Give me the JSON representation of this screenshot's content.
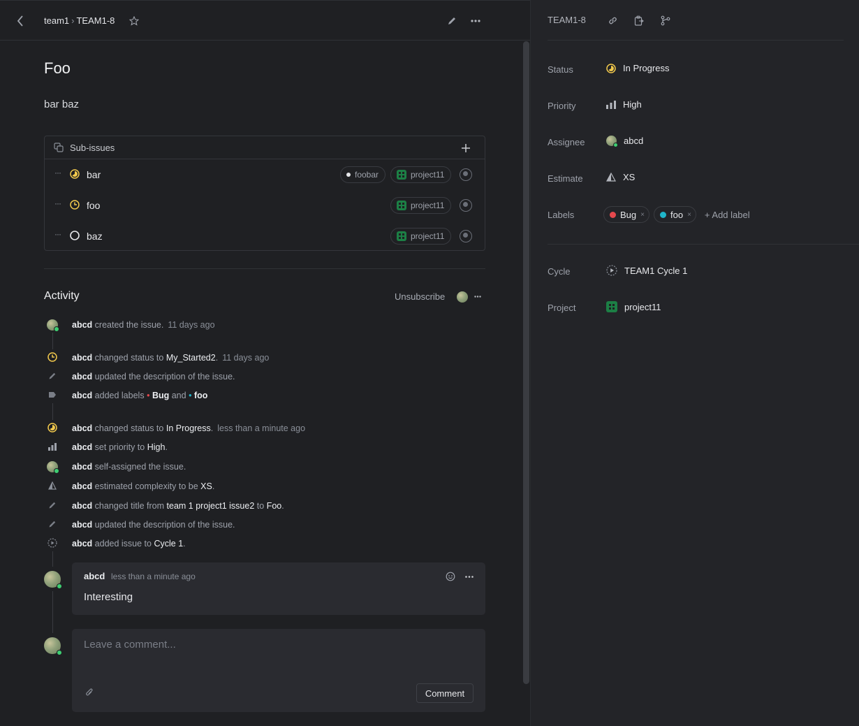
{
  "header": {
    "team": "team1",
    "separator": "›",
    "issue_id": "TEAM1-8"
  },
  "issue": {
    "title": "Foo",
    "description": "bar baz"
  },
  "sub_issues": {
    "header_label": "Sub-issues",
    "items": [
      {
        "name": "bar",
        "label": "foobar",
        "project": "project11"
      },
      {
        "name": "foo",
        "project": "project11"
      },
      {
        "name": "baz",
        "project": "project11"
      }
    ]
  },
  "activity": {
    "title": "Activity",
    "unsubscribe_label": "Unsubscribe",
    "events": [
      {
        "user": "abcd",
        "text": "created the issue.",
        "time": "11 days ago"
      },
      {
        "user": "abcd",
        "text": "changed status to",
        "value": "My_Started2",
        "end": ".",
        "time": "11 days ago"
      },
      {
        "user": "abcd",
        "text": "updated the description of the issue."
      },
      {
        "user": "abcd",
        "text": "added labels",
        "value1": "Bug",
        "mid": "and",
        "value2": "foo"
      },
      {
        "user": "abcd",
        "text": "changed status to",
        "value": "In Progress",
        "end": ".",
        "time": "less than a minute ago"
      },
      {
        "user": "abcd",
        "text": "set priority to",
        "value": "High",
        "end": "."
      },
      {
        "user": "abcd",
        "text": "self-assigned the issue."
      },
      {
        "user": "abcd",
        "text": "estimated complexity to be",
        "value": "XS",
        "end": "."
      },
      {
        "user": "abcd",
        "text": "changed title from",
        "value1": "team 1 project1 issue2",
        "mid": "to",
        "value2": "Foo",
        "end": "."
      },
      {
        "user": "abcd",
        "text": "updated the description of the issue."
      },
      {
        "user": "abcd",
        "text": "added issue to",
        "value": "Cycle 1",
        "end": "."
      }
    ]
  },
  "comment": {
    "author": "abcd",
    "time": "less than a minute ago",
    "body": "Interesting"
  },
  "new_comment": {
    "placeholder": "Leave a comment...",
    "button_label": "Comment"
  },
  "sidebar": {
    "issue_id": "TEAM1-8",
    "properties": {
      "status_label": "Status",
      "status_value": "In Progress",
      "priority_label": "Priority",
      "priority_value": "High",
      "assignee_label": "Assignee",
      "assignee_value": "abcd",
      "estimate_label": "Estimate",
      "estimate_value": "XS",
      "labels_label": "Labels",
      "labels": [
        {
          "name": "Bug",
          "color": "#e5484d"
        },
        {
          "name": "foo",
          "color": "#1fb5c9"
        }
      ],
      "add_label": "+ Add label",
      "cycle_label": "Cycle",
      "cycle_value": "TEAM1 Cycle 1",
      "project_label": "Project",
      "project_value": "project11"
    }
  },
  "colors": {
    "accent_yellow": "#f2c94c",
    "project_green": "#1c7f45",
    "online_green": "#3ecf72"
  }
}
